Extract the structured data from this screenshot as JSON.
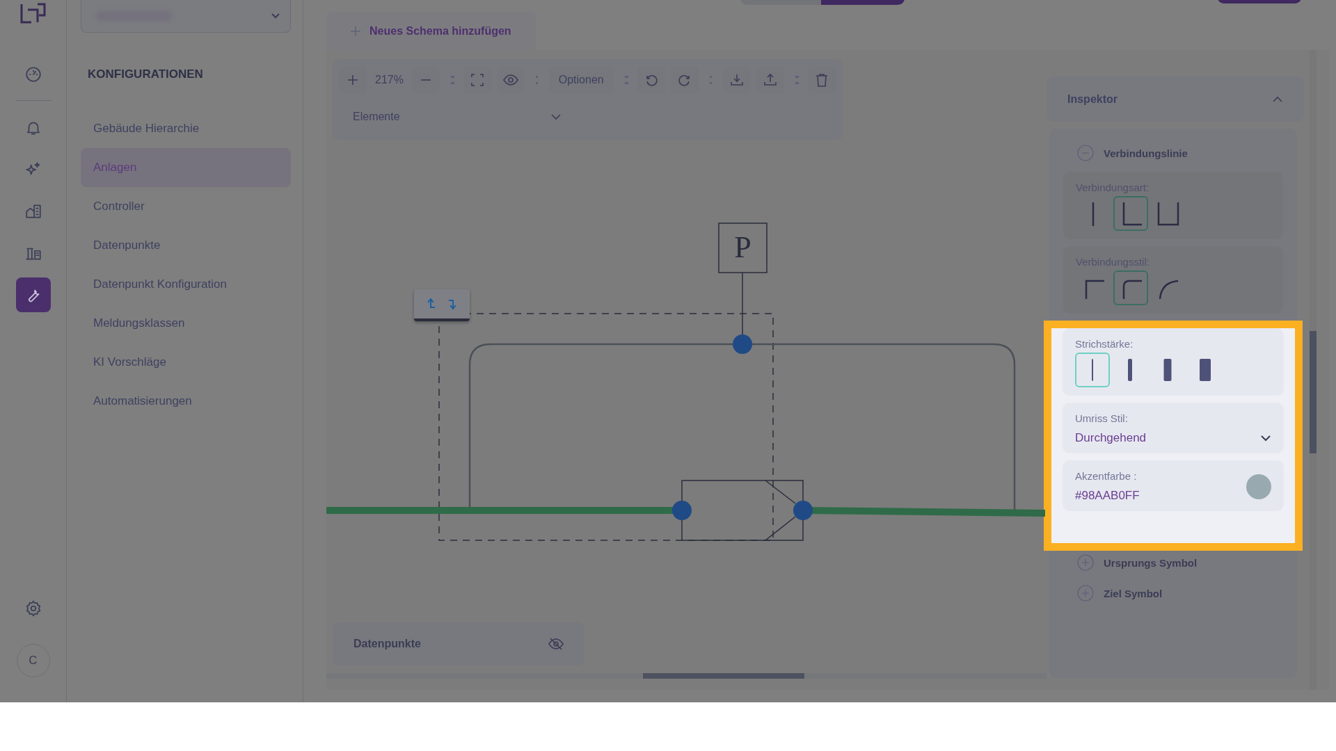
{
  "rail": {
    "items": [
      {
        "kind": "gauge",
        "selected": false
      },
      {
        "kind": "bell",
        "selected": false
      },
      {
        "kind": "sparkle",
        "selected": false
      },
      {
        "kind": "building",
        "selected": false
      },
      {
        "kind": "factory",
        "selected": false
      },
      {
        "kind": "wrench",
        "selected": true
      }
    ],
    "avatar": "C"
  },
  "sidebar": {
    "title": "KONFIGURATIONEN",
    "items": [
      {
        "label": "Gebäude Hierarchie",
        "selected": false
      },
      {
        "label": "Anlagen",
        "selected": true
      },
      {
        "label": "Controller",
        "selected": false
      },
      {
        "label": "Datenpunkte",
        "selected": false
      },
      {
        "label": "Datenpunkt Konfiguration",
        "selected": false
      },
      {
        "label": "Meldungsklassen",
        "selected": false
      },
      {
        "label": "KI Vorschläge",
        "selected": false
      },
      {
        "label": "Automatisierungen",
        "selected": false
      }
    ]
  },
  "add_tab": {
    "label": "Neues Schema hinzufügen"
  },
  "toolbar": {
    "zoom": "217%",
    "options_label": "Optionen",
    "elements_label": "Elemente"
  },
  "diagram": {
    "symbol_label": "P"
  },
  "datapoints_panel": {
    "title": "Datenpunkte"
  },
  "inspector": {
    "title": "Inspektor",
    "line_section": {
      "label": "Verbindungslinie",
      "expanded": true
    },
    "connection_type": {
      "label": "Verbindungsart:",
      "options": [
        {
          "kind": "straight",
          "selected": false
        },
        {
          "kind": "angled",
          "selected": true
        },
        {
          "kind": "u",
          "selected": false
        }
      ]
    },
    "connection_style": {
      "label": "Verbindungsstil:",
      "options": [
        {
          "kind": "sharp",
          "selected": false
        },
        {
          "kind": "rounded",
          "selected": true
        },
        {
          "kind": "curved",
          "selected": false
        }
      ]
    },
    "stroke_width": {
      "label": "Strichstärke:",
      "options": [
        {
          "kind": "thin",
          "selected": true
        },
        {
          "kind": "medium",
          "selected": false
        },
        {
          "kind": "thick",
          "selected": false
        },
        {
          "kind": "heavy",
          "selected": false
        }
      ]
    },
    "outline_style": {
      "label": "Umriss Stil:",
      "value": "Durchgehend"
    },
    "accent_color": {
      "label": "Akzentfarbe :",
      "value": "#98AAB0FF",
      "color": "#98aab0"
    },
    "collapsed_sections": [
      {
        "label": "Ursprungs Symbol",
        "expanded": false
      },
      {
        "label": "Ziel Symbol",
        "expanded": false
      }
    ]
  }
}
